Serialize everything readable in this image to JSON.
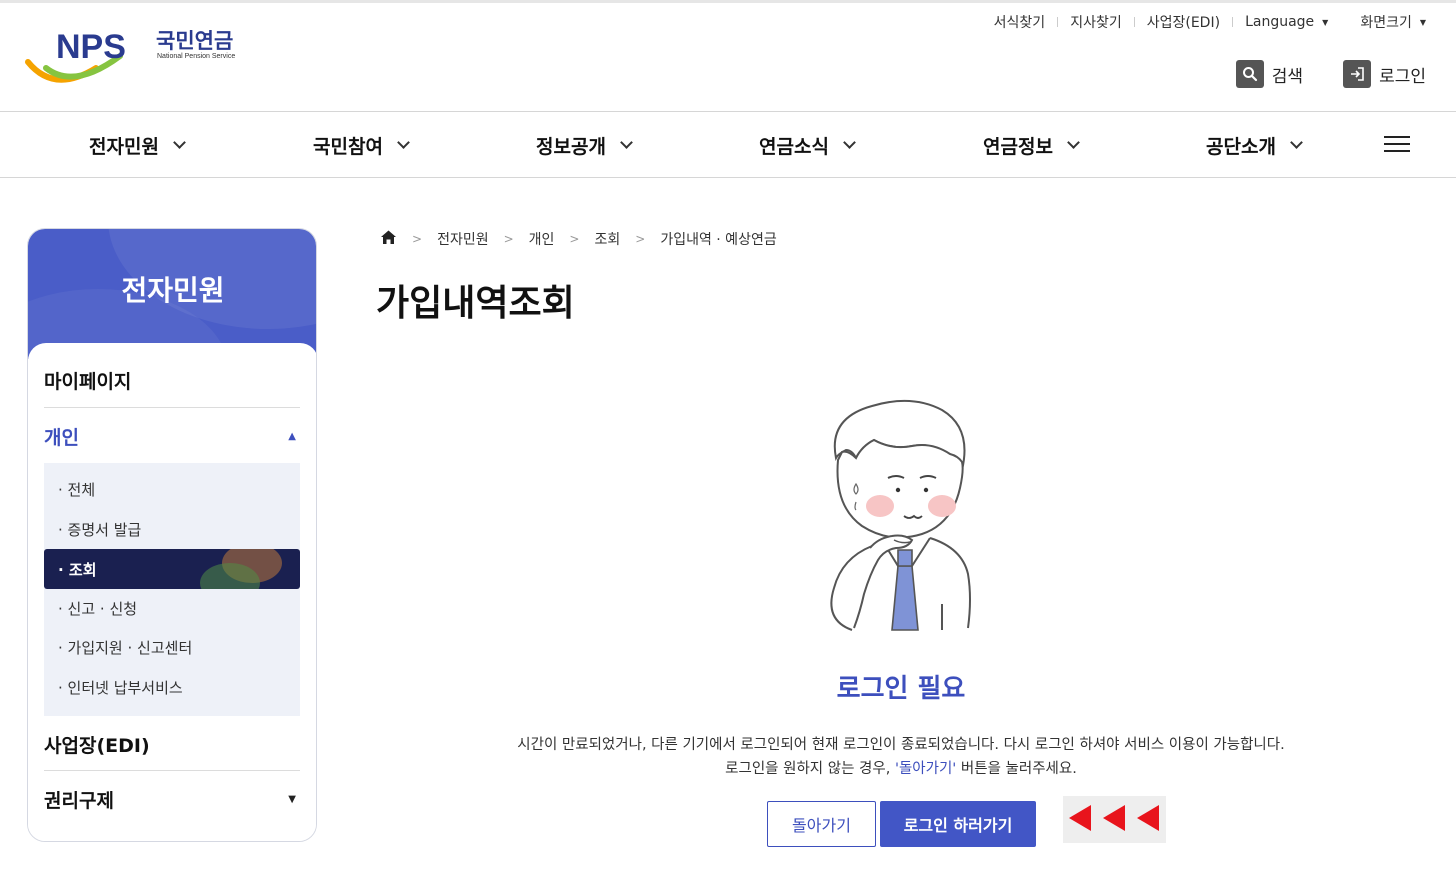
{
  "header": {
    "logo": {
      "text_en": "NPS",
      "text_ko": "국민연금",
      "subtitle": "National Pension Service"
    },
    "utility": [
      {
        "label": "서식찾기",
        "has_caret": false
      },
      {
        "label": "지사찾기",
        "has_caret": false
      },
      {
        "label": "사업장(EDI)",
        "has_caret": false
      },
      {
        "label": "Language",
        "has_caret": true
      },
      {
        "label": "화면크기",
        "has_caret": true
      }
    ],
    "search_label": "검색",
    "login_label": "로그인"
  },
  "gnb": {
    "items": [
      {
        "label": "전자민원"
      },
      {
        "label": "국민참여"
      },
      {
        "label": "정보공개"
      },
      {
        "label": "연금소식"
      },
      {
        "label": "연금정보"
      },
      {
        "label": "공단소개"
      }
    ]
  },
  "sidebar": {
    "title": "전자민원",
    "menus": [
      {
        "label": "마이페이지"
      },
      {
        "label": "개인",
        "expanded": true
      },
      {
        "label": "사업장(EDI)"
      },
      {
        "label": "권리구제",
        "expanded": false
      }
    ],
    "submenu": [
      {
        "label": "· 전체"
      },
      {
        "label": "· 증명서 발급"
      },
      {
        "label": "· 조회",
        "active": true
      },
      {
        "label": "· 신고 · 신청"
      },
      {
        "label": "· 가입지원 · 신고센터"
      },
      {
        "label": "· 인터넷 납부서비스"
      }
    ]
  },
  "breadcrumb": [
    "전자민원",
    "개인",
    "조회",
    "가입내역 · 예상연금"
  ],
  "page": {
    "title": "가입내역조회",
    "notice_title": "로그인 필요",
    "message_line1": "시간이 만료되었거나, 다른 기기에서 로그인되어 현재 로그인이 종료되었습니다. 다시 로그인 하셔야 서비스 이용이 가능합니다.",
    "message_line2_pre": "로그인을 원하지 않는 경우, ",
    "message_line2_hl": "'돌아가기'",
    "message_line2_post": " 버튼을 눌러주세요.",
    "back_button": "돌아가기",
    "login_button": "로그인 하러가기"
  },
  "colors": {
    "primary": "#4256c6",
    "sidebar_head": "#4a5dc8",
    "active_item": "#1a2050",
    "arrow_red": "#e8141c",
    "logo_navy": "#2a3b8f"
  }
}
